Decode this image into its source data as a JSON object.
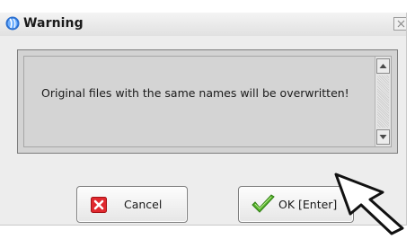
{
  "dialog": {
    "title": "Warning",
    "message": "Original files with the same names will be overwritten!"
  },
  "buttons": {
    "cancel_label": "Cancel",
    "ok_label": "OK [Enter]"
  },
  "icons": {
    "title": "app-logo-icon",
    "close": "close-icon",
    "cancel": "red-x-icon",
    "ok": "green-check-icon",
    "cursor": "mouse-pointer-icon",
    "scroll_up": "scroll-up-arrow-icon",
    "scroll_down": "scroll-down-arrow-icon"
  },
  "colors": {
    "cancel_icon": "#e0282e",
    "ok_icon": "#56b32e",
    "title_icon": "#2a6fd0"
  }
}
